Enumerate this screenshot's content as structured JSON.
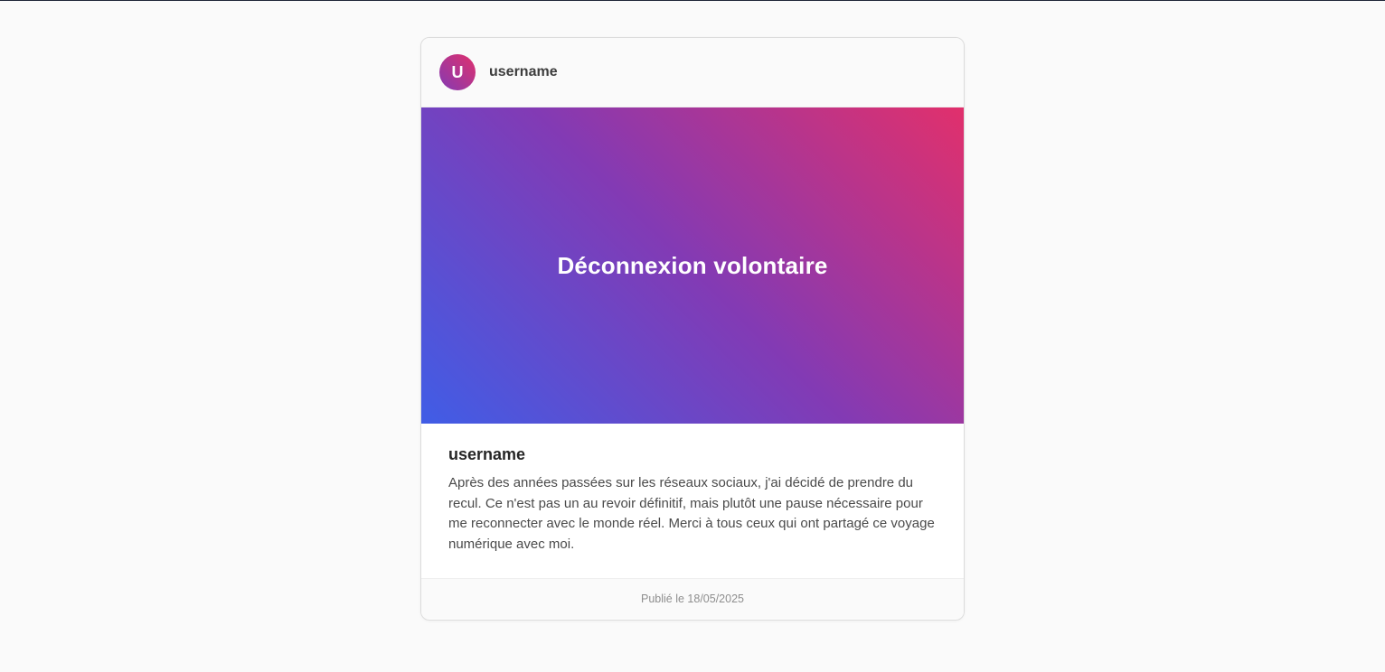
{
  "header": {
    "avatar_initial": "U",
    "username": "username"
  },
  "hero": {
    "title": "Déconnexion volontaire"
  },
  "post": {
    "username": "username",
    "text": "Après des années passées sur les réseaux sociaux, j'ai décidé de prendre du recul. Ce n'est pas un au revoir définitif, mais plutôt une pause nécessaire pour me reconnecter avec le monde réel. Merci à tous ceux qui ont partagé ce voyage numérique avec moi."
  },
  "footer": {
    "published": "Publié le 18/05/2025"
  },
  "colors": {
    "gradient_start": "#405de6",
    "gradient_mid": "#833ab4",
    "gradient_end": "#e1306c",
    "page_background": "#fafafa"
  }
}
